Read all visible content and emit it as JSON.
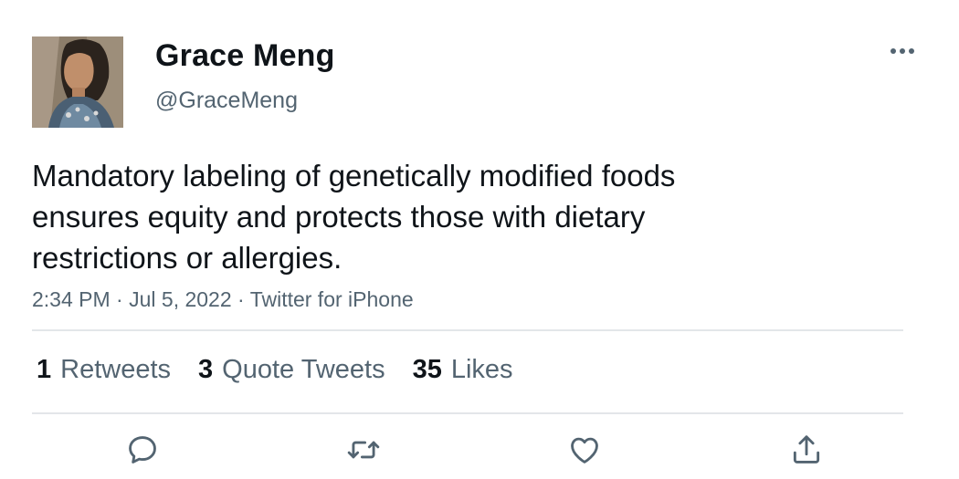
{
  "user": {
    "display_name": "Grace Meng",
    "handle": "@GraceMeng",
    "avatar": "profile-photo"
  },
  "tweet": {
    "text": "Mandatory labeling of genetically modified foods ensures equity and protects those with dietary restrictions or allergies.",
    "time": "2:34 PM",
    "separator": "·",
    "date": "Jul 5, 2022",
    "source": "Twitter for iPhone"
  },
  "stats": {
    "retweets": {
      "count": "1",
      "label": "Retweets"
    },
    "quote_tweets": {
      "count": "3",
      "label": "Quote Tweets"
    },
    "likes": {
      "count": "35",
      "label": "Likes"
    }
  },
  "actions": [
    "reply-icon",
    "retweet-icon",
    "like-icon",
    "share-icon"
  ],
  "menu_icon": "more-dots-icon",
  "colors": {
    "text_primary": "#0f1419",
    "text_secondary": "#536471",
    "divider": "#e3e6e9"
  }
}
